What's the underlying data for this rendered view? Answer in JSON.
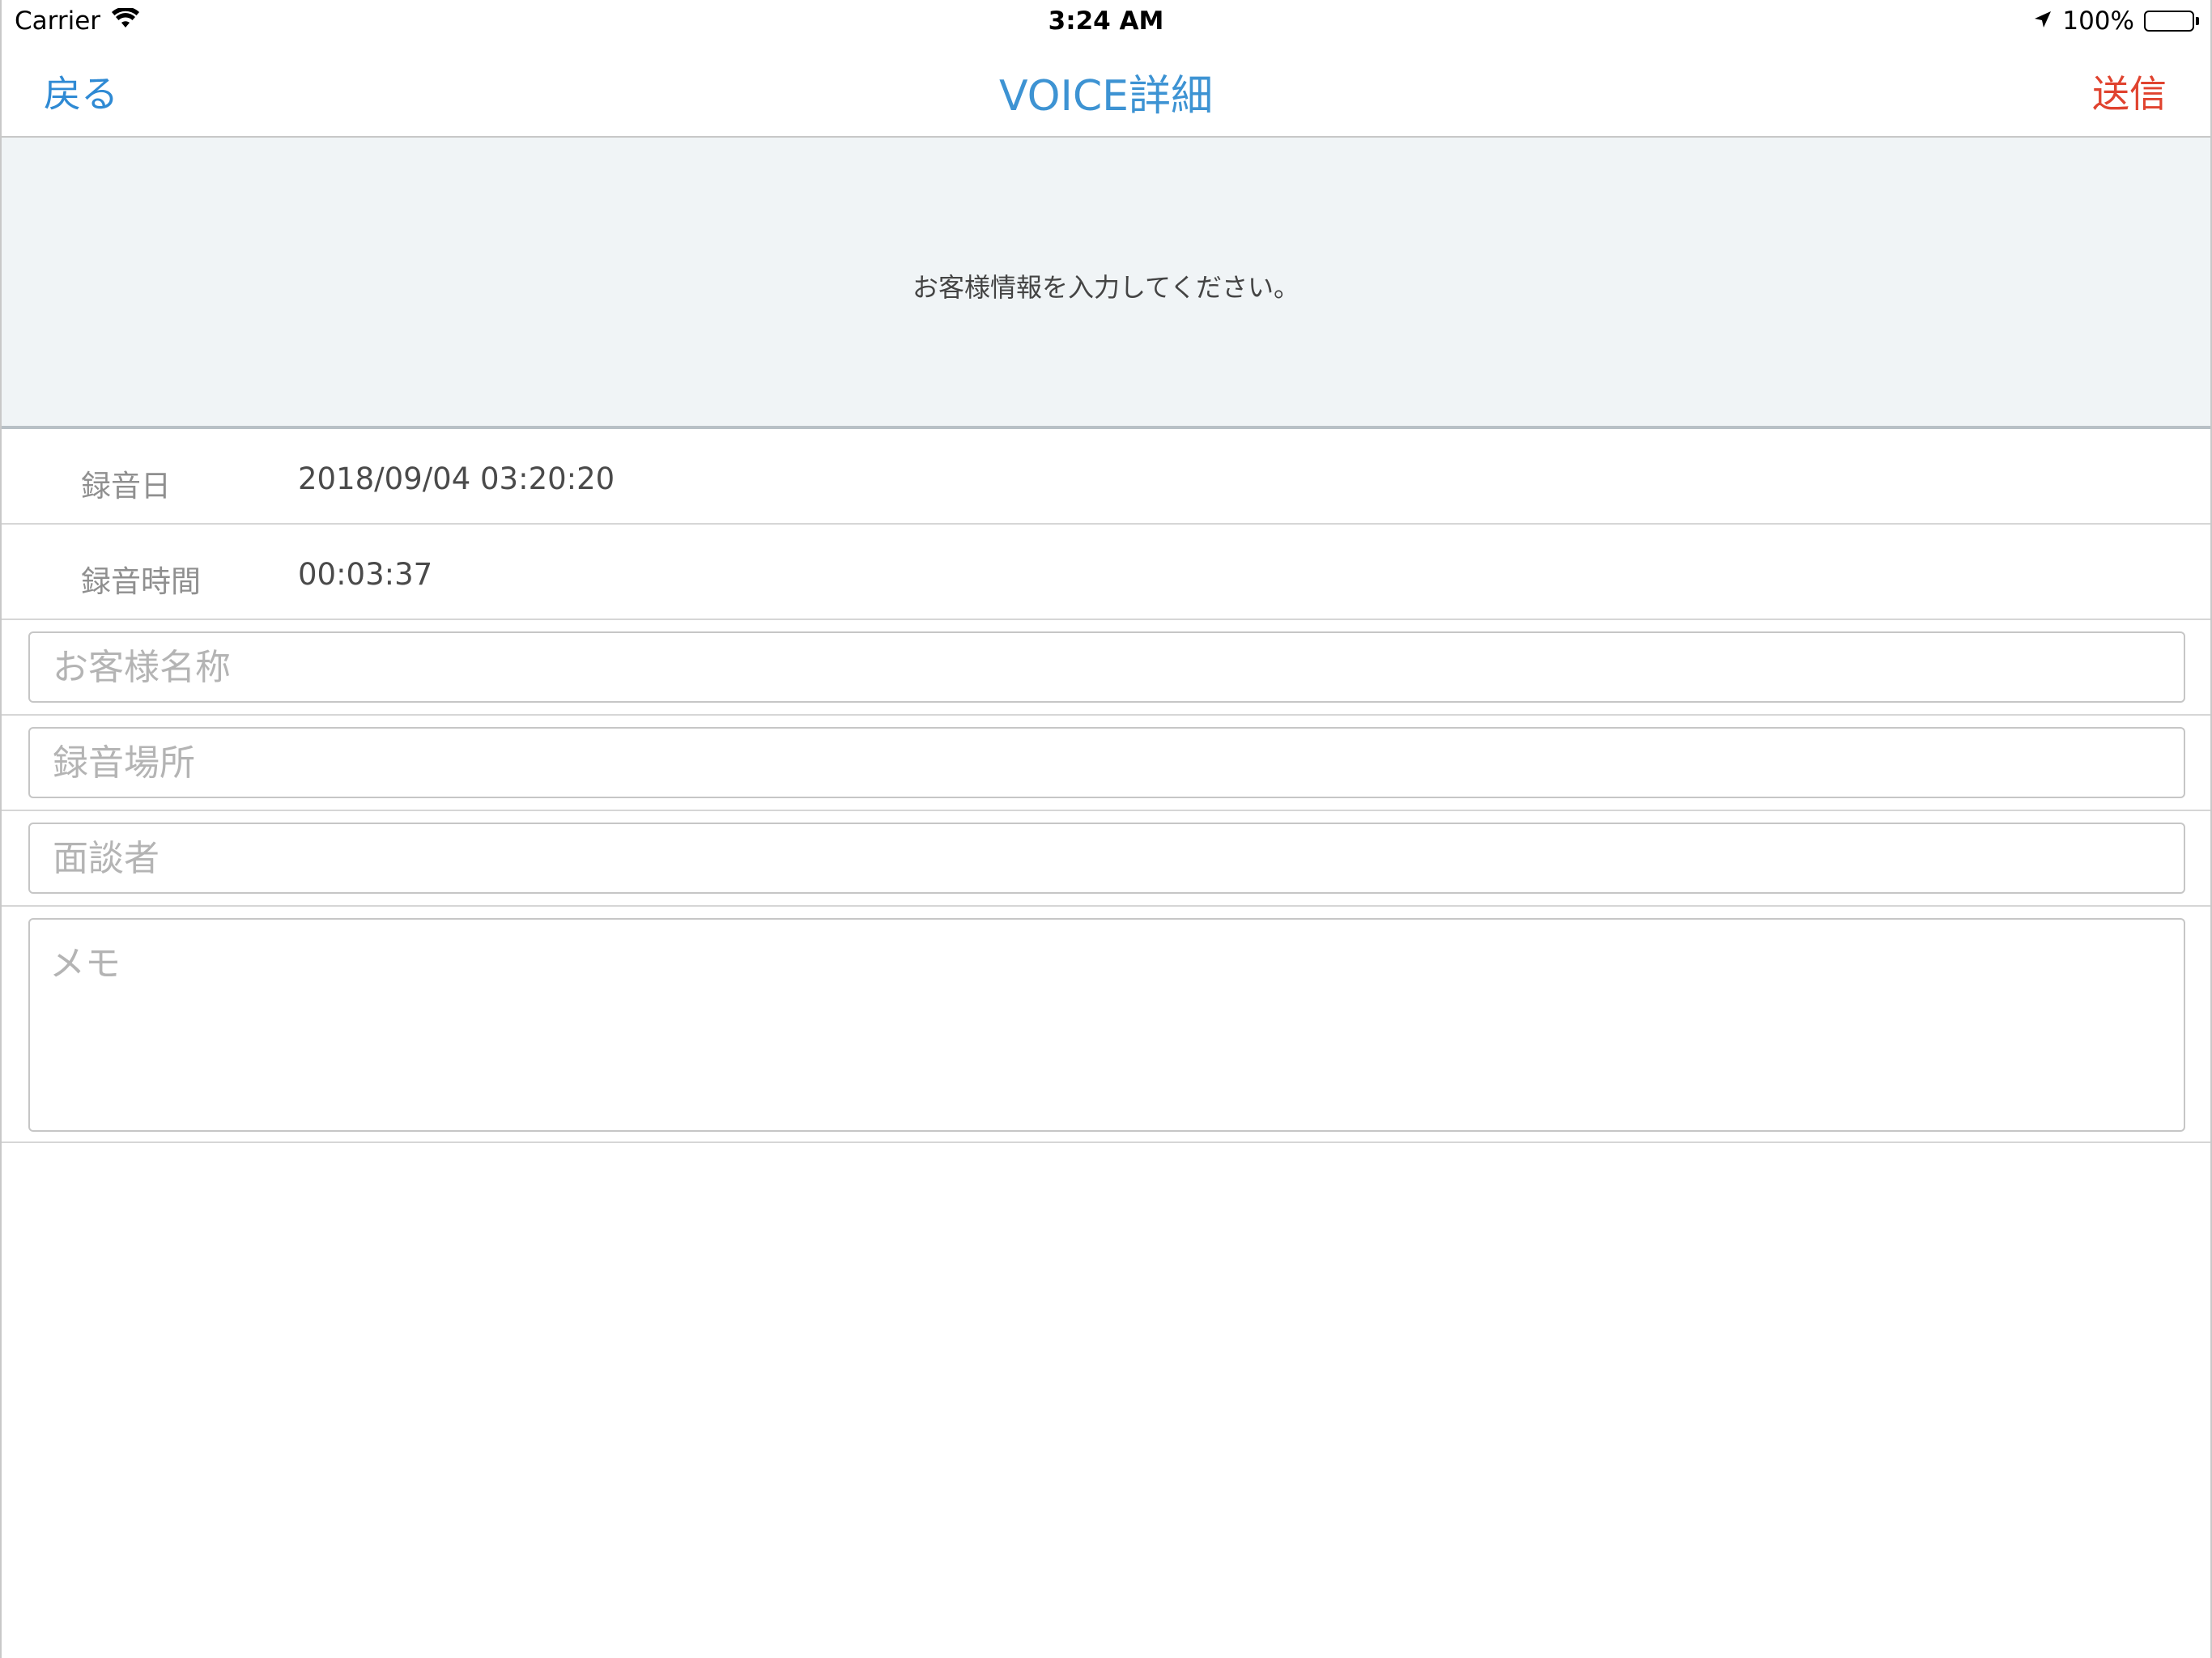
{
  "status_bar": {
    "carrier": "Carrier",
    "time": "3:24 AM",
    "battery": "100%",
    "icons": [
      "wifi-icon",
      "location-arrow-icon",
      "battery-icon"
    ]
  },
  "nav": {
    "back_label": "戻る",
    "title": "VOICE詳細",
    "send_label": "送信"
  },
  "banner": {
    "message": "お客様情報を入力してください。"
  },
  "info": {
    "recording_date_label": "録音日",
    "recording_date_value": "2018/09/04 03:20:20",
    "recording_duration_label": "録音時間",
    "recording_duration_value": "00:03:37"
  },
  "form": {
    "customer_name_placeholder": "お客様名称",
    "customer_name_value": "",
    "location_placeholder": "録音場所",
    "location_value": "",
    "interviewer_placeholder": "面談者",
    "interviewer_value": "",
    "memo_placeholder": "メモ",
    "memo_value": ""
  },
  "colors": {
    "nav_blue": "#2f8ad4",
    "send_red": "#e0432f",
    "banner_bg": "#f0f4f6"
  }
}
